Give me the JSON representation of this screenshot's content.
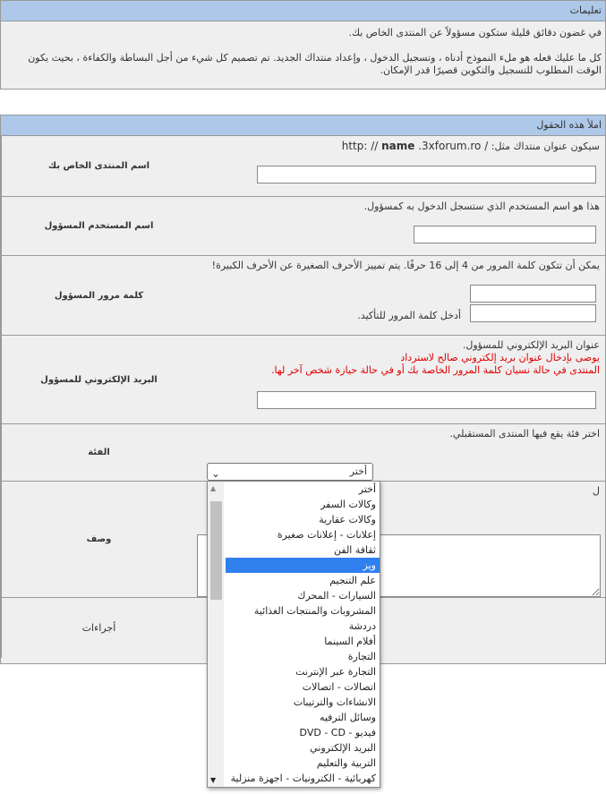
{
  "instructions": {
    "header": "تعليمات",
    "line1": "في غضون دقائق قليلة ستكون مسؤولاً عن المنتدى الخاص بك.",
    "line2": "كل ما عليك فعله هو ملء النموذج أدناه ، وتسجيل الدخول ، وإعداد منتداك الجديد. تم تصميم كل شيء من أجل البساطة والكفاءة ، بحيث يكون الوقت المطلوب للتسجيل والتكوين قصيرًا قدر الإمكان."
  },
  "form": {
    "header": "املأ هذه الحقول",
    "forum_name": {
      "label": "اسم المنتدى الخاص بك",
      "hint": "سيكون عنوان منتداك مثل:",
      "url_prefix": "http: // ",
      "url_name": "name",
      "url_suffix": " .3xforum.ro /"
    },
    "admin_user": {
      "label": "اسم المستخدم المسؤول",
      "hint": "هذا هو اسم المستخدم الذي ستسجل الدخول به كمسؤول."
    },
    "admin_password": {
      "label": "كلمة مرور المسؤول",
      "hint": "يمكن أن تتكون كلمة المرور من 4 إلى 16 حرفًا. يتم تمييز الأحرف الصغيرة عن الأحرف الكبيرة!",
      "confirm_hint": "أدخل كلمة المرور للتأكيد."
    },
    "admin_email": {
      "label": "البريد الإلكتروني للمسؤول",
      "hint": "عنوان البريد الإلكتروني للمسؤول.",
      "warning1": "يوصى بإدخال عنوان بريد إلكتروني صالح لاسترداد",
      "warning2": "المنتدى في حالة نسيان كلمة المرور الخاصة بك أو في حالة حيازة شخص آخر لها."
    },
    "category": {
      "label": "الفئة",
      "hint": "اختر فئة يقع فيها المنتدى المستقبلي.",
      "selected": "أختر",
      "chevron": "chevron-down-icon",
      "options": [
        "أختر",
        "وكالات السفر",
        "وكالات عقارية",
        "إعلانات - إعلانات صغيرة",
        "ثقافة الفن",
        "ويز",
        "علم التنجيم",
        "السيارات - المحرك",
        "المشروبات والمنتجات الغذائية",
        "دردشة",
        "أفلام السينما",
        "التجارة",
        "التجارة عبر الإنترنت",
        "اتصالات - اتصالات",
        "الانشاءات والترتيبات",
        "وسائل الترفيه",
        "فيديو - DVD - CD",
        "البريد الإلكتروني",
        "التربية والتعليم",
        "كهربائية - الكترونيات - اجهزة منزلية"
      ],
      "highlighted_index": 5
    },
    "description": {
      "label": "وصف",
      "hint_visible": "ل"
    },
    "actions": {
      "label": "أجراءات"
    }
  },
  "colors": {
    "header_bg": "#adc8e8",
    "panel_bg": "#efefef",
    "warning": "#e00000",
    "highlight": "#2f80ed"
  }
}
